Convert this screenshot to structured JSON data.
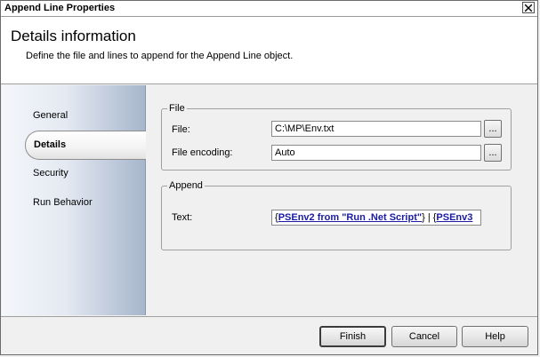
{
  "window": {
    "title": "Append Line Properties"
  },
  "header": {
    "title": "Details information",
    "subtitle": "Define the file and lines to append for the Append Line object."
  },
  "sidebar": {
    "items": [
      {
        "label": "General",
        "selected": false
      },
      {
        "label": "Details",
        "selected": true
      },
      {
        "label": "Security",
        "selected": false
      },
      {
        "label": "Run Behavior",
        "selected": false
      }
    ]
  },
  "file_group": {
    "legend": "File",
    "file_label": "File:",
    "file_value": "C:\\MP\\Env.txt",
    "encoding_label": "File encoding:",
    "encoding_value": "Auto",
    "browse_label": "..."
  },
  "append_group": {
    "legend": "Append",
    "text_label": "Text:",
    "text_open": "{",
    "text_link1": "PSEnv2 from \"Run .Net Script\"",
    "text_mid": "} | {",
    "text_link2": "PSEnv3"
  },
  "buttons": {
    "finish": "Finish",
    "cancel": "Cancel",
    "help": "Help"
  },
  "icons": {
    "close": "close-x-icon"
  }
}
